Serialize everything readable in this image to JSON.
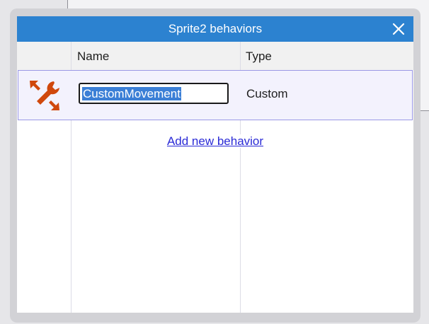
{
  "dialog": {
    "title": "Sprite2 behaviors"
  },
  "table": {
    "columns": [
      "Name",
      "Type"
    ],
    "rows": [
      {
        "icon": "custom-behavior-wrench-icon",
        "name": "CustomMovement",
        "type": "Custom"
      }
    ]
  },
  "actions": {
    "add_new_behavior": "Add new behavior"
  },
  "colors": {
    "titlebar": "#2c82d0",
    "row_selected_bg": "#f3f2fd",
    "row_selected_border": "#9a98e6",
    "text_selection": "#3b7fd6",
    "link": "#2a2ad6",
    "icon_orange": "#d0480c"
  }
}
